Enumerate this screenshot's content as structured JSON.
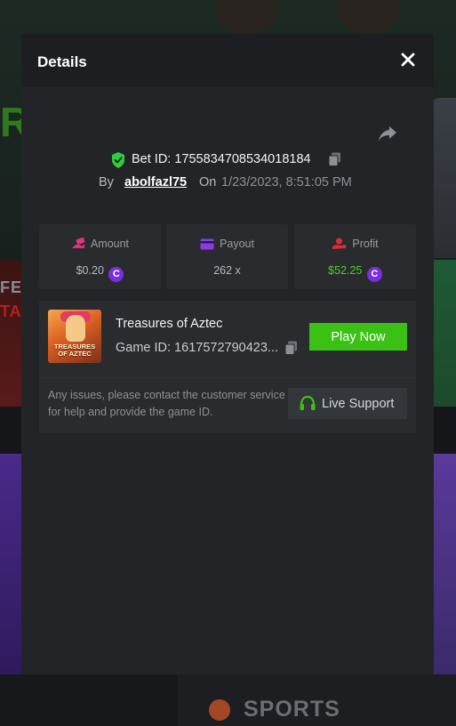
{
  "modal": {
    "title": "Details",
    "bet_id": "Bet ID: 1755834708534018184",
    "by_label": "By",
    "username": "abolfazl75",
    "on_label": "On",
    "date": "1/23/2023, 8:51:05 PM"
  },
  "stats": {
    "amount_label": "Amount",
    "amount_value": "$0.20",
    "payout_label": "Payout",
    "payout_value": "262 x",
    "profit_label": "Profit",
    "profit_value": "$52.25",
    "currency_symbol": "C"
  },
  "game": {
    "name": "Treasures of Aztec",
    "game_id": "Game ID: 1617572790423...",
    "thumbnail_text": "TREASURES OF AZTEC",
    "play_label": "Play Now",
    "issue_text": "Any issues, please contact the customer service for help and provide the game ID.",
    "support_label": "Live Support"
  },
  "background": {
    "left_text_1": "FEA",
    "left_text_2": "TAR",
    "left_text_green": "R",
    "sports_label": "SPORTS"
  },
  "colors": {
    "accent_green": "#3bc114",
    "profit_green": "#4ad41f",
    "coin_purple": "#7b2ee0",
    "payout_purple": "#8a3ce0",
    "amount_pink": "#e0327a",
    "profit_red": "#e02a3a",
    "shield_green": "#2ecc40"
  },
  "icons": {
    "close": "close-icon",
    "share": "share-icon",
    "shield": "shield-check-icon",
    "copy": "copy-icon",
    "amount": "money-hand-icon",
    "payout": "card-icon",
    "profit": "profit-hand-icon",
    "support": "headset-icon"
  }
}
